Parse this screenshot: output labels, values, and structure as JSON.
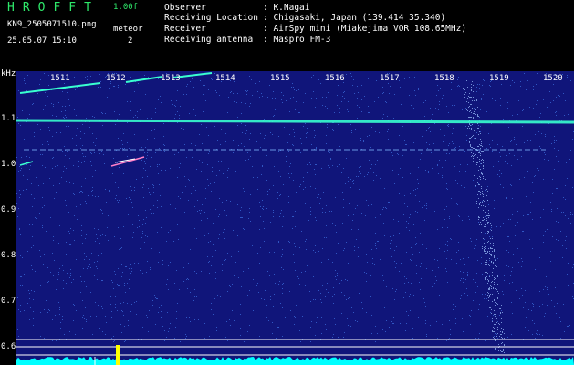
{
  "header": {
    "app_title": "HROFFT",
    "app_version": "1.00f",
    "filename": "KN9_2505071510.png",
    "timestamp": "25.05.07 15:10",
    "mode_label": "meteor",
    "mode_count": "2",
    "meta": [
      {
        "label": "Observer",
        "value": ": K.Nagai"
      },
      {
        "label": "Receiving Location",
        "value": ": Chigasaki, Japan (139.414 35.340)"
      },
      {
        "label": "Receiver",
        "value": ": AirSpy mini (Miakejima VOR 108.65MHz)"
      },
      {
        "label": "Receiving antenna",
        "value": ": Maspro FM-3"
      }
    ]
  },
  "spectrogram": {
    "unit": "kHz",
    "y_ticks": [
      "1.1",
      "1.0",
      "0.9",
      "0.8",
      "0.7",
      "0.6"
    ],
    "time_ticks": [
      "1511",
      "1512",
      "1513",
      "1514",
      "1515",
      "1516",
      "1517",
      "1518",
      "1519",
      "1520"
    ],
    "colors": {
      "background": "#10157a",
      "carrier": "#39ffd0",
      "noise": "#4a8cff",
      "grid": "#ffffff",
      "spectrum": "#00ffff",
      "peak": "#ffff00"
    }
  }
}
